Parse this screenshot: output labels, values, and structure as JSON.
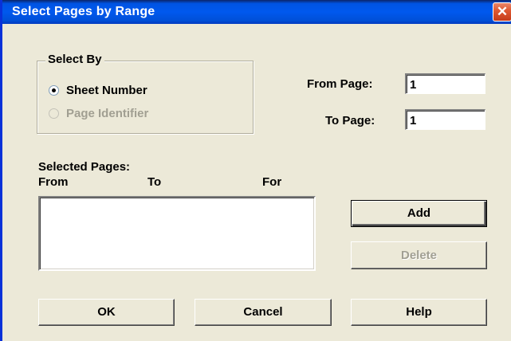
{
  "window": {
    "title": "Select Pages by Range",
    "close_glyph": "✕"
  },
  "select_by": {
    "legend": "Select By",
    "options": [
      {
        "label": "Sheet Number",
        "checked": true,
        "enabled": true
      },
      {
        "label": "Page Identifier",
        "checked": false,
        "enabled": false
      }
    ]
  },
  "range": {
    "from_label": "From Page:",
    "from_value": "1",
    "to_label": "To Page:",
    "to_value": "1"
  },
  "selected_pages": {
    "label": "Selected Pages:",
    "columns": [
      "From",
      "To",
      "For"
    ],
    "rows": []
  },
  "buttons": {
    "add": "Add",
    "delete": "Delete",
    "ok": "OK",
    "cancel": "Cancel",
    "help": "Help"
  }
}
